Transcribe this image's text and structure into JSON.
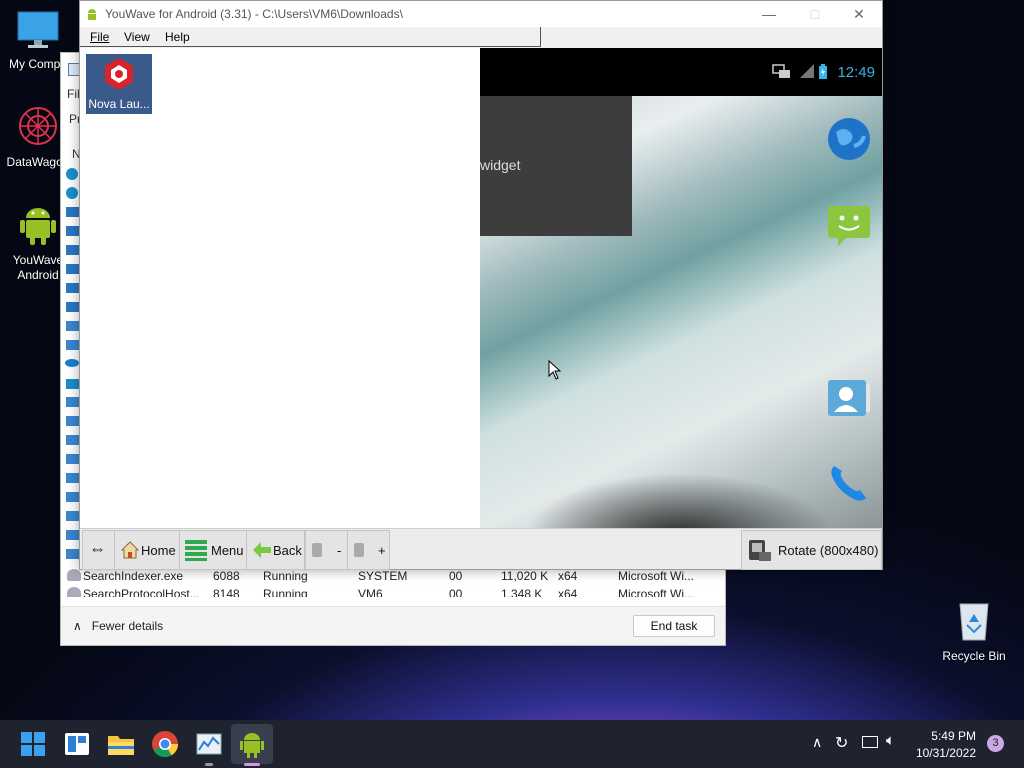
{
  "desktop": {
    "icons": [
      {
        "label": "My Compu"
      },
      {
        "label": "DataWagon"
      },
      {
        "label": "YouWave Android"
      },
      {
        "label": "Recycle Bin"
      }
    ]
  },
  "taskmgr": {
    "side_labels": {
      "fi": "Fil",
      "pr": "Pr",
      "n": "N"
    },
    "rows": [
      {
        "name": "SearchIndexer.exe",
        "pid": "6088",
        "status": "Running",
        "user": "SYSTEM",
        "cpu": "00",
        "mem": "11,020 K",
        "arch": "x64",
        "desc": "Microsoft Wi..."
      },
      {
        "name": "SearchProtocolHost...",
        "pid": "8148",
        "status": "Running",
        "user": "VM6",
        "cpu": "00",
        "mem": "1,348 K",
        "arch": "x64",
        "desc": "Microsoft Wi..."
      }
    ],
    "fewer_details": "Fewer details",
    "end_task": "End task"
  },
  "youwave": {
    "title": "YouWave for Android (3.31) - C:\\Users\\VM6\\Downloads\\",
    "menu": {
      "file": "File",
      "view": "View",
      "help": "Help"
    },
    "apps": [
      {
        "label": "Nova Lau..."
      }
    ],
    "android": {
      "clock": "12:49",
      "widget_text": "widget"
    },
    "toolbar": {
      "home": "Home",
      "menu": "Menu",
      "back": "Back",
      "vol_minus": "-",
      "vol_plus": "+",
      "rotate": "Rotate (800x480)"
    }
  },
  "taskbar": {
    "time": "5:49 PM",
    "date": "10/31/2022",
    "notifications": "3"
  }
}
